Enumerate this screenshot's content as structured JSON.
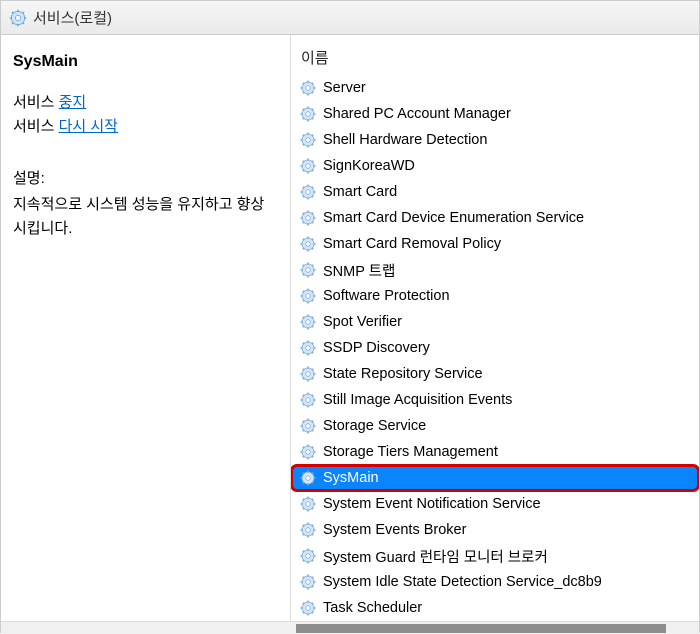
{
  "window": {
    "title": "서비스(로컬)"
  },
  "detail": {
    "selected_name": "SysMain",
    "action_prefix": "서비스 ",
    "stop_link": "중지",
    "restart_link": "다시 시작",
    "desc_label": "설명:",
    "desc_text": "지속적으로 시스템 성능을 유지하고 향상시킵니다."
  },
  "list": {
    "header": "이름",
    "items": [
      {
        "label": "Server",
        "selected": false
      },
      {
        "label": "Shared PC Account Manager",
        "selected": false
      },
      {
        "label": "Shell Hardware Detection",
        "selected": false
      },
      {
        "label": "SignKoreaWD",
        "selected": false
      },
      {
        "label": "Smart Card",
        "selected": false
      },
      {
        "label": "Smart Card Device Enumeration Service",
        "selected": false
      },
      {
        "label": "Smart Card Removal Policy",
        "selected": false
      },
      {
        "label": "SNMP 트랩",
        "selected": false
      },
      {
        "label": "Software Protection",
        "selected": false
      },
      {
        "label": "Spot Verifier",
        "selected": false
      },
      {
        "label": "SSDP Discovery",
        "selected": false
      },
      {
        "label": "State Repository Service",
        "selected": false
      },
      {
        "label": "Still Image Acquisition Events",
        "selected": false
      },
      {
        "label": "Storage Service",
        "selected": false
      },
      {
        "label": "Storage Tiers Management",
        "selected": false
      },
      {
        "label": "SysMain",
        "selected": true
      },
      {
        "label": "System Event Notification Service",
        "selected": false
      },
      {
        "label": "System Events Broker",
        "selected": false
      },
      {
        "label": "System Guard 런타임 모니터 브로커",
        "selected": false
      },
      {
        "label": "System Idle State Detection Service_dc8b9",
        "selected": false
      },
      {
        "label": "Task Scheduler",
        "selected": false
      }
    ]
  }
}
